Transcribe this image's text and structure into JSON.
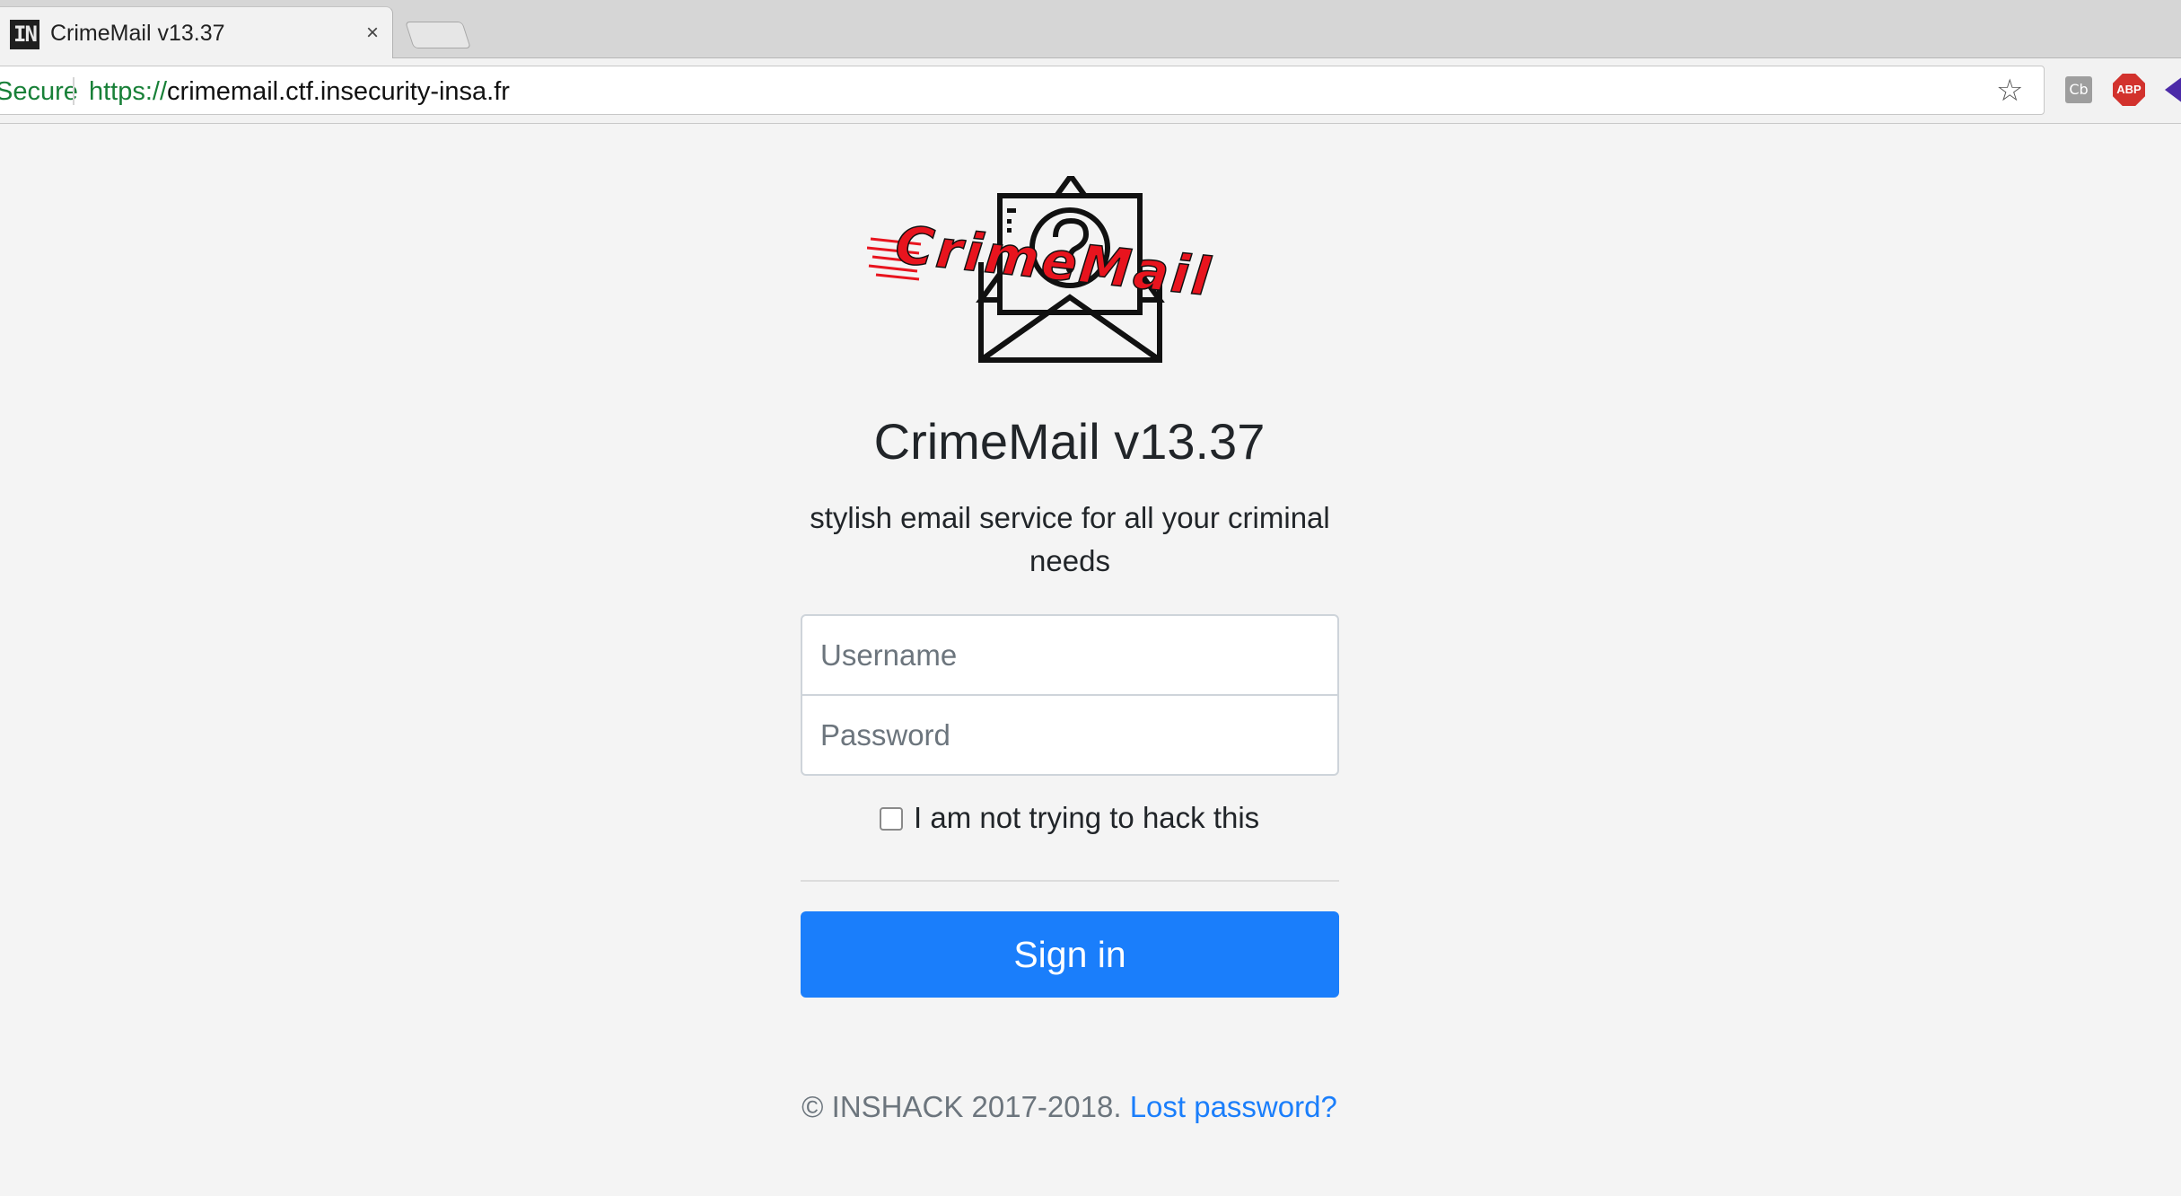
{
  "browser": {
    "tab": {
      "favicon_text": "IN",
      "title": "CrimeMail v13.37",
      "close_symbol": "×"
    },
    "address_bar": {
      "security_label": "Secure",
      "url_scheme": "https://",
      "url_host": "crimemail.ctf.insecurity-insa.fr"
    },
    "extensions": {
      "cb_label": "Cb",
      "abp_label": "ABP"
    }
  },
  "page": {
    "logo_text": "CrimeMail",
    "title": "CrimeMail v13.37",
    "subtitle": "stylish email service for all your criminal needs",
    "form": {
      "username_placeholder": "Username",
      "password_placeholder": "Password",
      "checkbox_label": "I am not trying to hack this",
      "submit_label": "Sign in"
    },
    "footer": {
      "copyright": "© INSHACK 2017-2018.",
      "lost_password_link": "Lost password?"
    }
  },
  "colors": {
    "accent": "#1a7efb",
    "secure_green": "#188038",
    "logo_red": "#e8141e"
  },
  "icons": [
    "star-icon",
    "close-icon",
    "envelope-question-icon"
  ]
}
